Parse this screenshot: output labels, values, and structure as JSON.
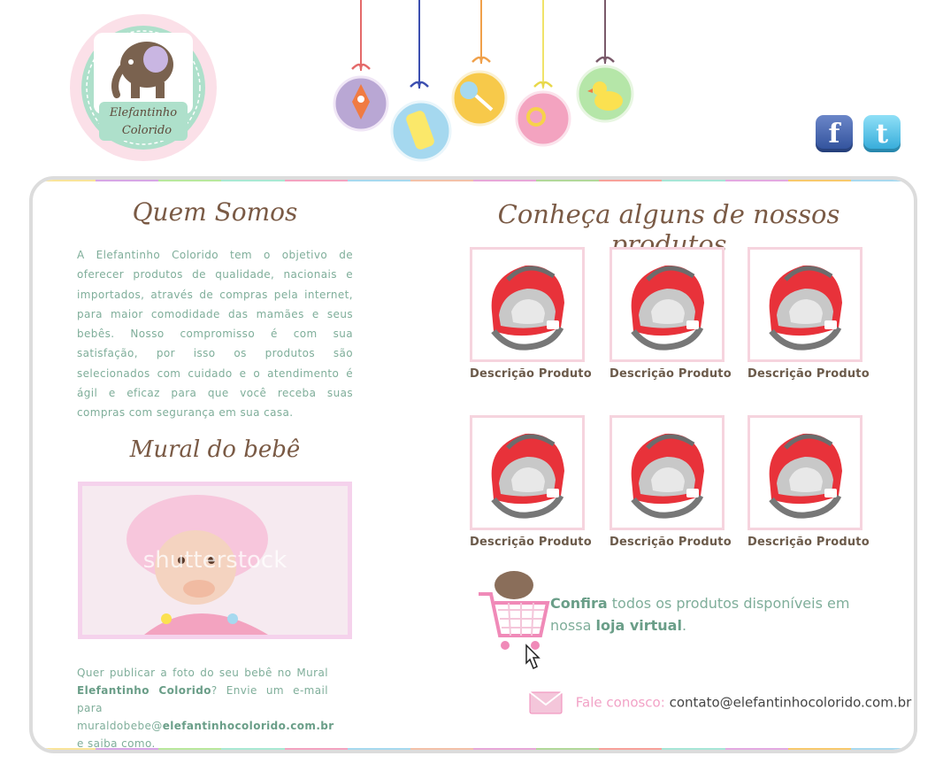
{
  "logo": {
    "text_line1": "Elefantinho",
    "text_line2": "Colorido"
  },
  "social": {
    "facebook_label": "f",
    "twitter_label": "t"
  },
  "stripe_colors": [
    "#f9e49a",
    "#d7a6e6",
    "#b9e89d",
    "#a9e9d3",
    "#f3a3c0",
    "#a6d9ef",
    "#f3c1a8",
    "#e7a7d8",
    "#b2d89a",
    "#f7a19a",
    "#a7e6d7",
    "#e3a9e1",
    "#f7c96d",
    "#a8d9ef"
  ],
  "about": {
    "title": "Quem Somos",
    "text": "A Elefantinho Colorido tem o objetivo de oferecer produtos de qualidade, nacionais e importados, através de compras pela internet, para maior comodidade das mamães e seus bebês. Nosso compromisso é com sua satisfação, por isso os produtos são selecionados com cuidado e o atendimento é ágil e eficaz para que você receba suas compras com segurança em sua casa."
  },
  "mural": {
    "title": "Mural do bebê",
    "watermark": "shutterstock",
    "text_before": "Quer publicar a foto do seu bebê no Mural ",
    "brand": "Elefantinho Colorido",
    "text_middle": "? Envie um e-mail para muraldobebe@",
    "email_domain": "elefantinhocolorido.com.br",
    "text_after": " e saiba como."
  },
  "products": {
    "title": "Conheça alguns de nossos produtos",
    "items": [
      {
        "caption": "Descrição Produto"
      },
      {
        "caption": "Descrição Produto"
      },
      {
        "caption": "Descrição Produto"
      },
      {
        "caption": "Descrição Produto"
      },
      {
        "caption": "Descrição Produto"
      },
      {
        "caption": "Descrição Produto"
      }
    ]
  },
  "cta": {
    "confira": "Confira",
    "text1": " todos os produtos disponíveis em nossa ",
    "store": "loja virtual",
    "text2": "."
  },
  "contact": {
    "label": "Fale conosco:",
    "email": "contato@elefantinhocolorido.com.br"
  }
}
